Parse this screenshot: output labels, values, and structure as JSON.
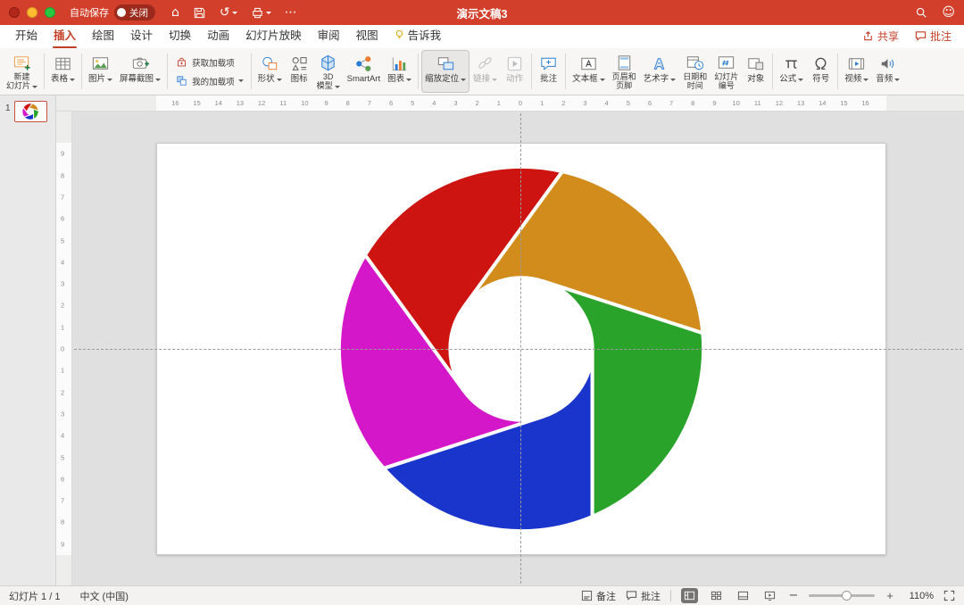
{
  "colors": {
    "titlebar_red": "#d2402c",
    "accent": "#c43e26"
  },
  "titlebar": {
    "title": "演示文稿3",
    "autosave_label": "自动保存",
    "autosave_state": "关闭"
  },
  "tabbar": {
    "tabs": [
      {
        "label": "开始",
        "active": false
      },
      {
        "label": "插入",
        "active": true
      },
      {
        "label": "绘图",
        "active": false
      },
      {
        "label": "设计",
        "active": false
      },
      {
        "label": "切换",
        "active": false
      },
      {
        "label": "动画",
        "active": false
      },
      {
        "label": "幻灯片放映",
        "active": false
      },
      {
        "label": "审阅",
        "active": false
      },
      {
        "label": "视图",
        "active": false
      },
      {
        "label": "告诉我",
        "active": false
      }
    ],
    "share": "共享",
    "comments": "批注"
  },
  "ribbon": {
    "new_slide": {
      "l1": "新建",
      "l2": "幻灯片"
    },
    "table": "表格",
    "pictures": "图片",
    "screenshot": "屏幕截图",
    "get_addins": "获取加载项",
    "my_addins": "我的加载项",
    "shapes": "形状",
    "icons": "图标",
    "model3d": {
      "l1": "3D",
      "l2": "模型"
    },
    "smartart": "SmartArt",
    "chart": "图表",
    "zoom": "缩放定位",
    "link": "链接",
    "action": "动作",
    "comment": "批注",
    "textbox": "文本框",
    "header_footer": {
      "l1": "页眉和",
      "l2": "页脚"
    },
    "wordart": "艺术字",
    "datetime": {
      "l1": "日期和",
      "l2": "时间"
    },
    "slide_number": {
      "l1": "幻灯片",
      "l2": "编号"
    },
    "object": "对象",
    "equation": "公式",
    "symbol": "符号",
    "video": "视频",
    "audio": "音频"
  },
  "slides_panel": {
    "number": "1"
  },
  "rulers": {
    "horizontal": [
      16,
      15,
      14,
      13,
      12,
      11,
      10,
      9,
      8,
      7,
      6,
      5,
      4,
      3,
      2,
      1,
      0,
      1,
      2,
      3,
      4,
      5,
      6,
      7,
      8,
      9,
      10,
      11,
      12,
      13,
      14,
      15,
      16
    ],
    "vertical": [
      9,
      8,
      7,
      6,
      5,
      4,
      3,
      2,
      1,
      0,
      1,
      2,
      3,
      4,
      5,
      6,
      7,
      8,
      9
    ]
  },
  "canvas": {
    "shape": {
      "type": "segmented-ring",
      "segments": [
        {
          "name": "blue",
          "color": "#1a35cc"
        },
        {
          "name": "magenta",
          "color": "#d417c9"
        },
        {
          "name": "red",
          "color": "#cd1410"
        },
        {
          "name": "gold",
          "color": "#d28c1b"
        },
        {
          "name": "green",
          "color": "#2aa32b"
        }
      ]
    }
  },
  "statusbar": {
    "slide_counter": "幻灯片 1 / 1",
    "language": "中文 (中国)",
    "notes": "备注",
    "comments": "批注",
    "zoom_level": "110%"
  }
}
